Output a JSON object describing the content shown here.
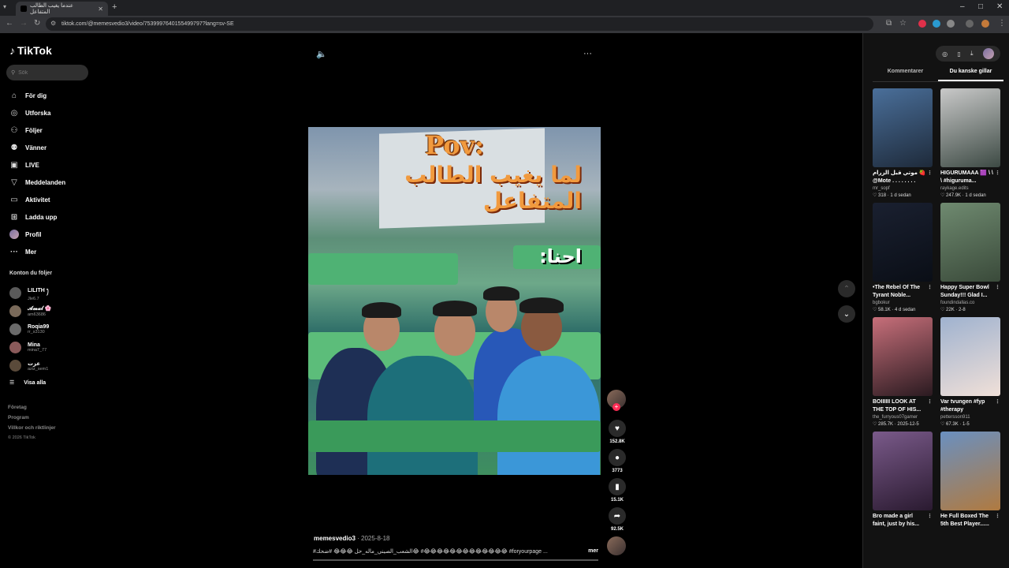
{
  "browser": {
    "tab_title": "عندما يغيب الطالب المتفاعل",
    "url": "tiktok.com/@memesvedio3/video/7539997640155499797?lang=sv-SE"
  },
  "sidebar": {
    "logo": "TikTok",
    "search_placeholder": "Sök",
    "nav": [
      {
        "label": "För dig",
        "icon": "home-icon",
        "glyph": "⌂"
      },
      {
        "label": "Utforska",
        "icon": "compass-icon",
        "glyph": "◎"
      },
      {
        "label": "Följer",
        "icon": "user-follow-icon",
        "glyph": "⚇"
      },
      {
        "label": "Vänner",
        "icon": "friends-icon",
        "glyph": "⚉"
      },
      {
        "label": "LIVE",
        "icon": "live-icon",
        "glyph": "▣"
      },
      {
        "label": "Meddelanden",
        "icon": "inbox-icon",
        "glyph": "▽"
      },
      {
        "label": "Aktivitet",
        "icon": "activity-icon",
        "glyph": "▭"
      },
      {
        "label": "Ladda upp",
        "icon": "upload-icon",
        "glyph": "⊞"
      },
      {
        "label": "Profil",
        "icon": "profile-avatar",
        "glyph": ""
      },
      {
        "label": "Mer",
        "icon": "more-icon",
        "glyph": "···"
      }
    ],
    "following_heading": "Konton du följer",
    "following": [
      {
        "name": "LILITH ꫂ",
        "handle": "Jle6.7",
        "color": "#5a5a5a"
      },
      {
        "name": "𝓐𝓶𝓪𝓵 🌸",
        "handle": "am63686",
        "color": "#7a6a5a"
      },
      {
        "name": "Roqia99",
        "handle": "rr_s3130",
        "color": "#6a6a6a"
      },
      {
        "name": "Mina",
        "handle": "mina7_77",
        "color": "#8a5a5a"
      },
      {
        "name": "عزت",
        "handle": "aziz_sem1",
        "color": "#5a4a3a"
      }
    ],
    "see_all": "Visa alla",
    "footer": [
      "Företag",
      "Program",
      "Villkor och riktlinjer"
    ],
    "copyright": "© 2026 TikTok"
  },
  "video": {
    "overlay_title": "Pov:",
    "overlay_line": "لما يغيب الطالب المتفاعل",
    "overlay_side": "احنا:"
  },
  "actions": {
    "likes": "152.8K",
    "comments": "3773",
    "saves": "15.1K",
    "shares": "92.5K"
  },
  "post": {
    "user": "memesvedio3",
    "date": " · 2025-8-18",
    "caption": "#الشعب_الصيني_ماله_حل 😂😂😂 #ضحك😂 #😂😂😂😂😂😂😂😂😂😂😂😂😂 #foryourpage ...",
    "more": "mer"
  },
  "right_panel": {
    "tabs": [
      "Kommentarer",
      "Du kanske gillar"
    ],
    "active_tab": 1,
    "cards": [
      {
        "title": "موتي قبل الزرام 🍓 @Mote . . . . . . . .",
        "author": "mr_sopf",
        "stats": "♡ 318 · 1 d sedan",
        "color1": "#4a6f9a",
        "color2": "#1e2a3a"
      },
      {
        "title": "HIGURUMAAA 🟪 \\ \\ \\ #higuruma...",
        "author": "raykage.edits",
        "stats": "♡ 247.9K · 1 d sedan",
        "color1": "#c9c9c9",
        "color2": "#3d4a44"
      },
      {
        "title": "•The Rebel Of The Tyrant Noble...",
        "author": "bgbokur",
        "stats": "♡ 58.1K · 4 d sedan",
        "color1": "#1a2030",
        "color2": "#0a0e16"
      },
      {
        "title": "Happy Super Bowl Sunday!!! Glad I...",
        "author": "foundindallas.co",
        "stats": "♡ 22K · 2-8",
        "color1": "#6f8a70",
        "color2": "#3a4a3a"
      },
      {
        "title": "BOIIIIII LOOK AT THE TOP OF HIS...",
        "author": "the_furryous07gamer",
        "stats": "♡ 285.7K · 2025-12-5",
        "color1": "#c76f7a",
        "color2": "#2a1a20"
      },
      {
        "title": "Var tvungen #fyp #therapy",
        "author": "pettersson911",
        "stats": "♡ 67.3K · 1-5",
        "color1": "#9fb2cf",
        "color2": "#f0e0d8"
      },
      {
        "title": "Bro made a girl faint, just by his...",
        "author": "",
        "stats": "",
        "color1": "#7a5a8a",
        "color2": "#2a1a30"
      },
      {
        "title": "He Full Boxed The 5th Best Player......",
        "author": "",
        "stats": "",
        "color1": "#6a90c0",
        "color2": "#b07a40"
      }
    ]
  },
  "colors": {
    "accent": "#fe2c55",
    "overlay_orange": "#f19a3e"
  }
}
